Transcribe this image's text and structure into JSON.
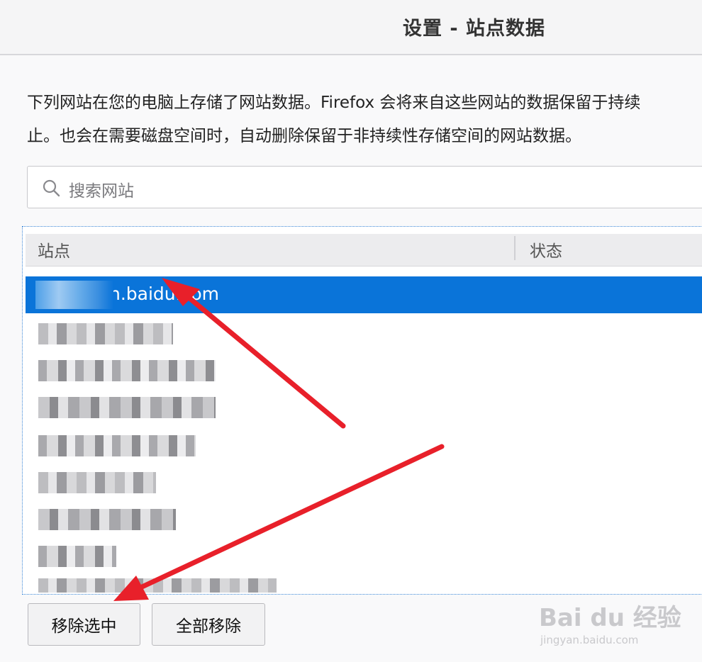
{
  "window": {
    "title": "设置 - 站点数据"
  },
  "description": {
    "line1": "下列网站在您的电脑上存储了网站数据。Firefox 会将来自这些网站的数据保留于持续",
    "line2": "止。也会在需要磁盘空间时，自动删除保留于非持续性存储空间的网站数据。"
  },
  "search": {
    "placeholder": "搜索网站",
    "icon": "search-icon"
  },
  "table": {
    "columns": [
      "站点",
      "状态"
    ],
    "selected_row": {
      "site": "n.baidu.com",
      "status": ""
    },
    "blurred_row_count": 8
  },
  "buttons": {
    "remove_selected": "移除选中",
    "remove_all": "全部移除"
  },
  "annotation": {
    "arrow_color": "#e8202a"
  },
  "watermark": {
    "logo": "Bai du 经验",
    "url": "jingyan.baidu.com"
  },
  "colors": {
    "selection": "#0a74d9",
    "header_bg": "#ececee",
    "focus_border": "#3a86d6"
  }
}
